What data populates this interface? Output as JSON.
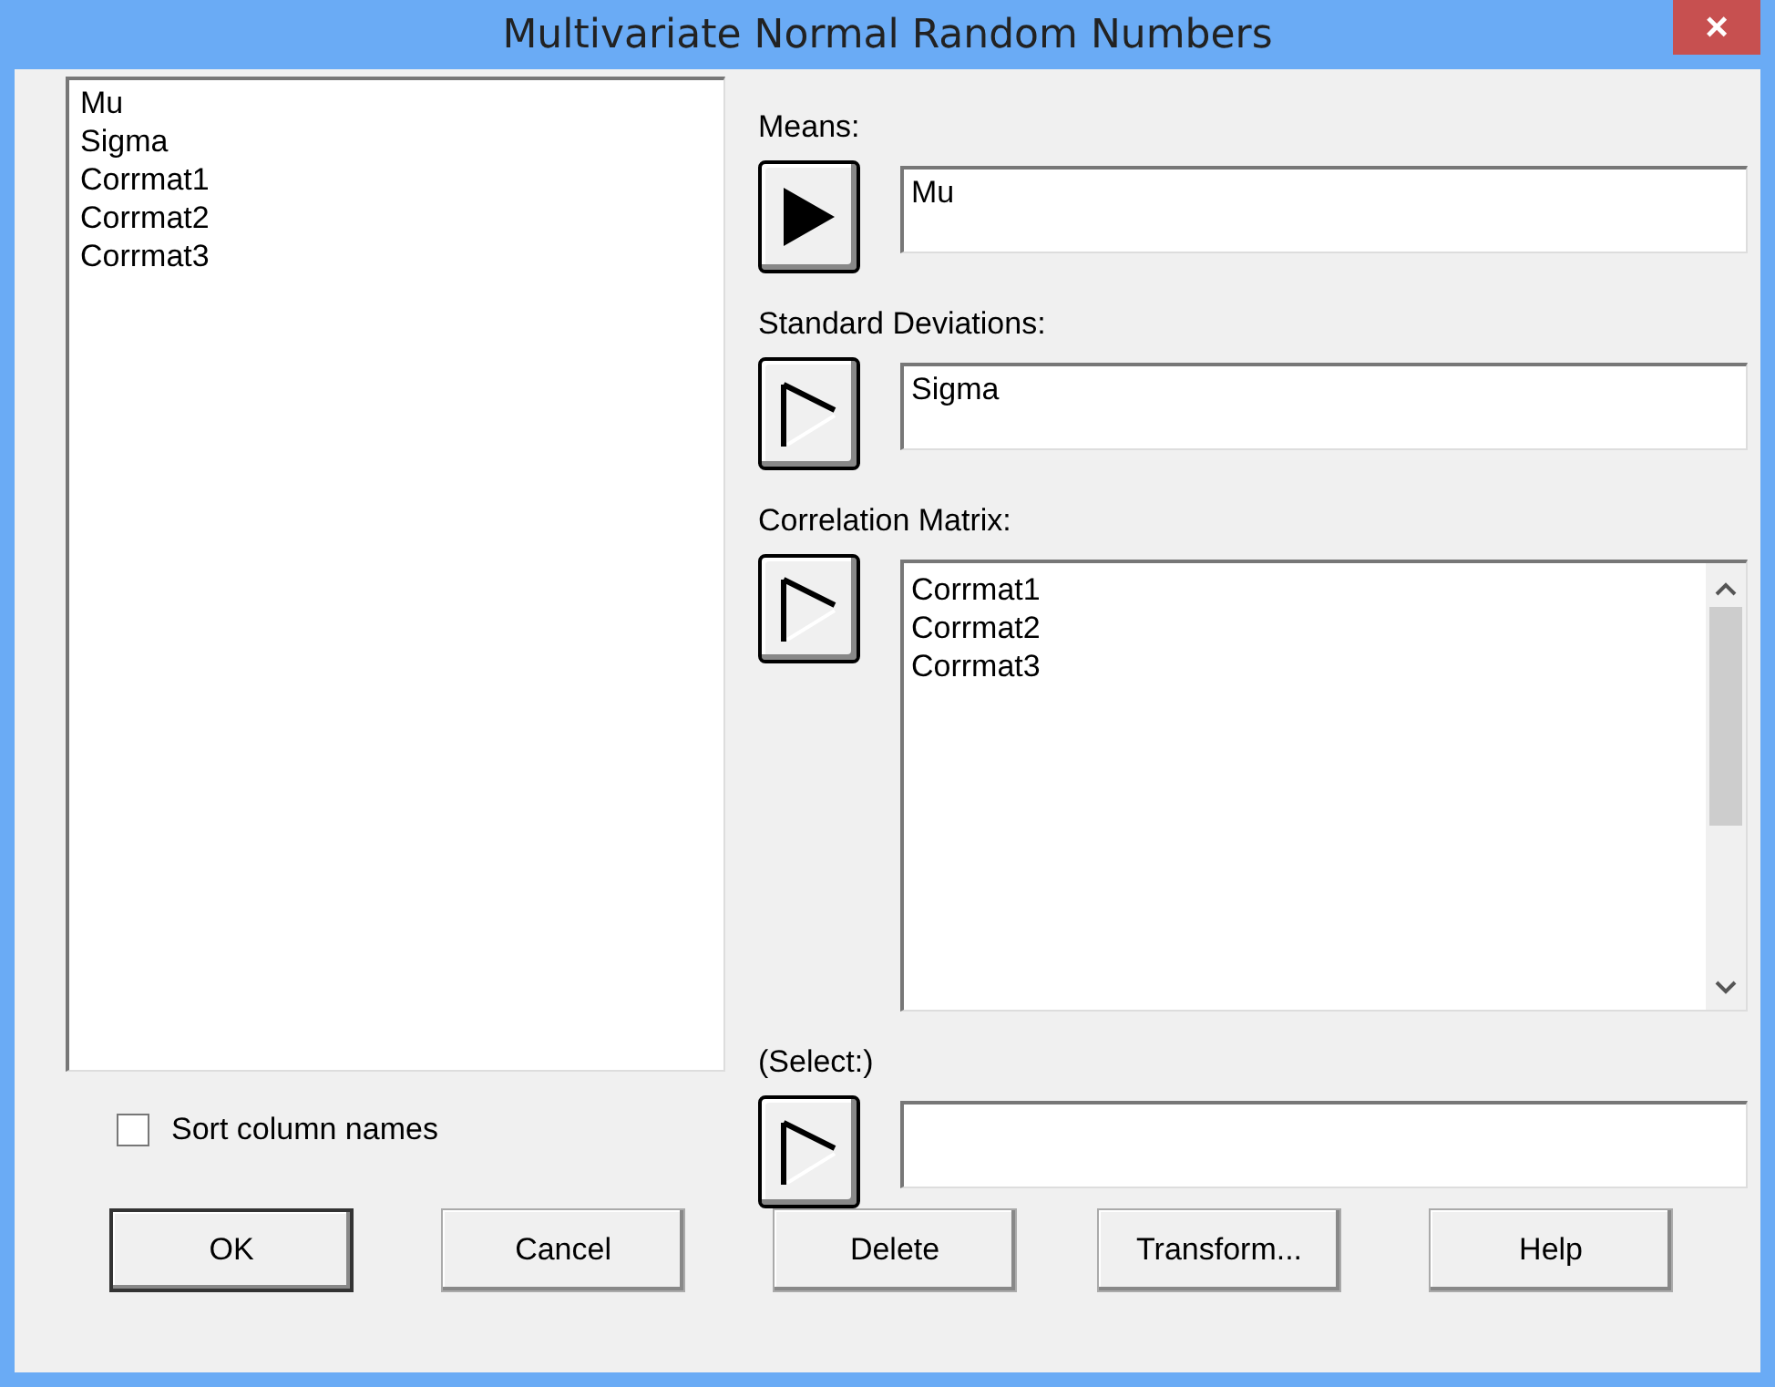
{
  "window": {
    "title": "Multivariate Normal Random Numbers",
    "close": "×"
  },
  "variables": {
    "items": [
      "Mu",
      "Sigma",
      "Corrmat1",
      "Corrmat2",
      "Corrmat3"
    ]
  },
  "sort_column_names": {
    "label": "Sort column names",
    "checked": false
  },
  "fields": [
    {
      "label": "Means:",
      "kind": "single",
      "active": true,
      "values": [
        "Mu"
      ]
    },
    {
      "label": "Standard Deviations:",
      "kind": "single",
      "active": false,
      "values": [
        "Sigma"
      ]
    },
    {
      "label": "Correlation Matrix:",
      "kind": "list",
      "active": false,
      "values": [
        "Corrmat1",
        "Corrmat2",
        "Corrmat3"
      ]
    },
    {
      "label": "(Select:)",
      "kind": "single",
      "active": false
    }
  ],
  "buttons": [
    "OK",
    "Cancel",
    "Delete",
    "Transform...",
    "Help"
  ]
}
